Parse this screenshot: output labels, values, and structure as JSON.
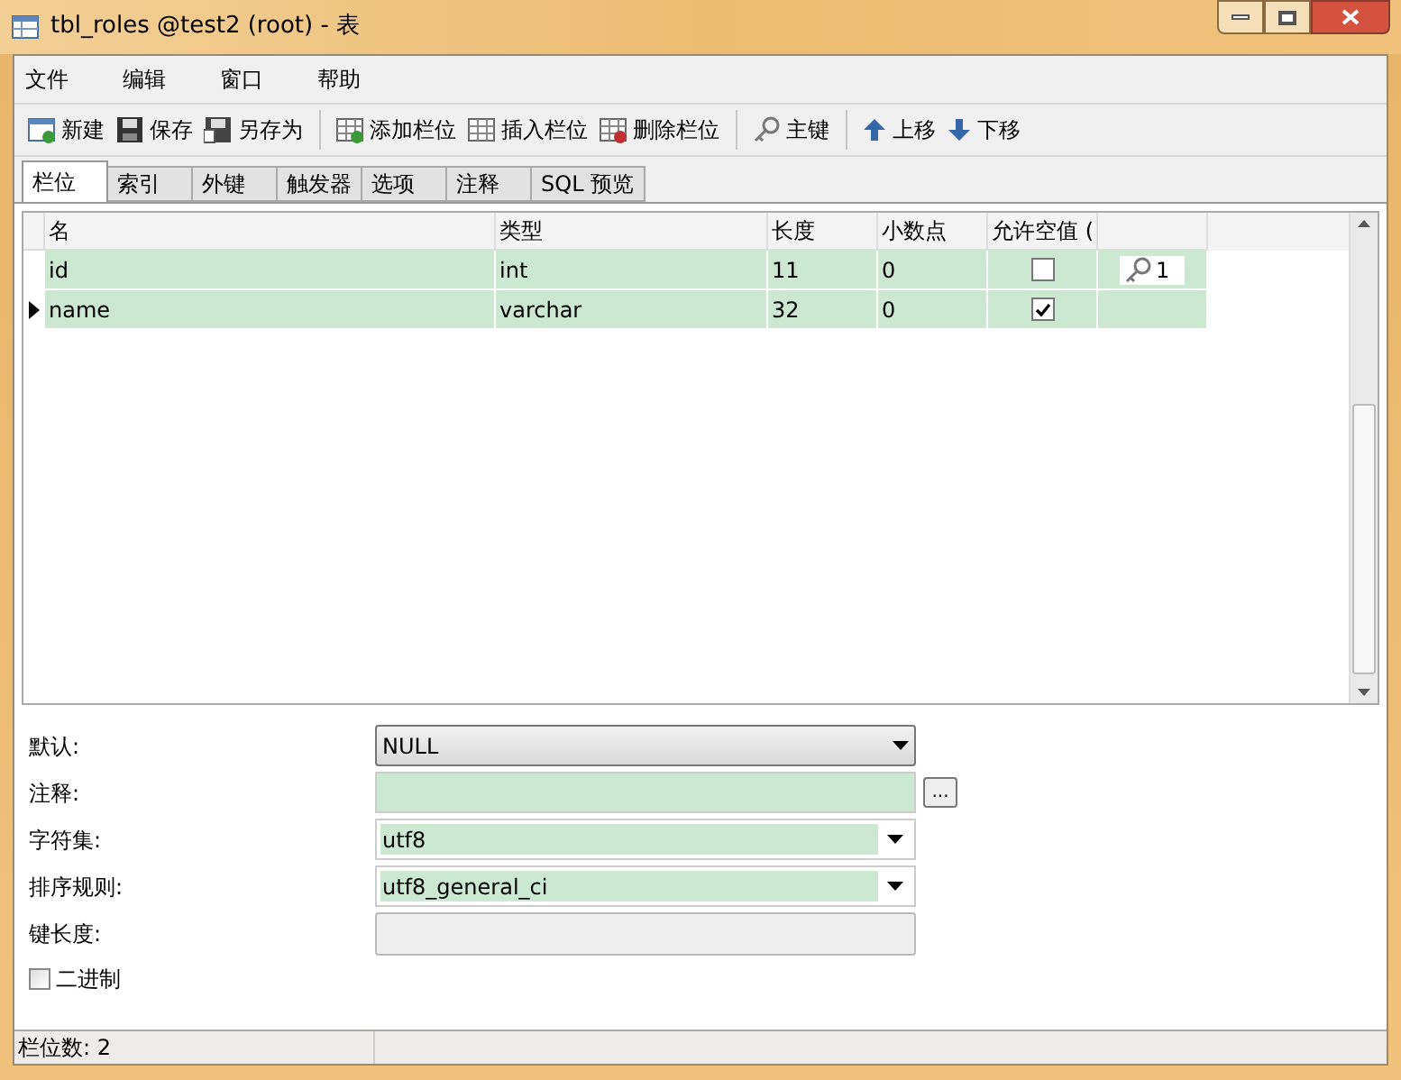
{
  "window": {
    "title": "tbl_roles @test2 (root) - 表"
  },
  "menu": [
    "文件",
    "编辑",
    "窗口",
    "帮助"
  ],
  "toolbar": [
    [
      {
        "label": "新建"
      },
      {
        "label": "保存"
      },
      {
        "label": "另存为"
      }
    ],
    [
      {
        "label": "添加栏位"
      },
      {
        "label": "插入栏位"
      },
      {
        "label": "删除栏位"
      }
    ],
    [
      {
        "label": "主键"
      }
    ],
    [
      {
        "label": "上移"
      },
      {
        "label": "下移"
      }
    ]
  ],
  "tabs": [
    {
      "label": "栏位",
      "selected": true
    },
    {
      "label": "索引",
      "selected": false
    },
    {
      "label": "外键",
      "selected": false
    },
    {
      "label": "触发器",
      "selected": false
    },
    {
      "label": "选项",
      "selected": false
    },
    {
      "label": "注释",
      "selected": false
    },
    {
      "label": "SQL 预览",
      "selected": false
    }
  ],
  "table": {
    "columns": [
      "名",
      "类型",
      "长度",
      "小数点",
      "允许空值 ("
    ],
    "rows": [
      {
        "name": "id",
        "type": "int",
        "length": "11",
        "decimals": "0",
        "allow_null": false,
        "key": "1",
        "selected": false
      },
      {
        "name": "name",
        "type": "varchar",
        "length": "32",
        "decimals": "0",
        "allow_null": true,
        "selected": true
      }
    ]
  },
  "properties": [
    {
      "label": "默认:",
      "kind": "dropdown",
      "value": "NULL"
    },
    {
      "label": "注释:",
      "kind": "text",
      "button": "..."
    },
    {
      "label": "字符集:",
      "kind": "combo",
      "value": "utf8"
    },
    {
      "label": "排序规则:",
      "kind": "combo",
      "value": "utf8_general_ci"
    },
    {
      "label": "键长度:",
      "kind": "disabled"
    }
  ],
  "binary": {
    "label": "二进制",
    "checked": false
  },
  "status_bar": "栏位数: 2"
}
